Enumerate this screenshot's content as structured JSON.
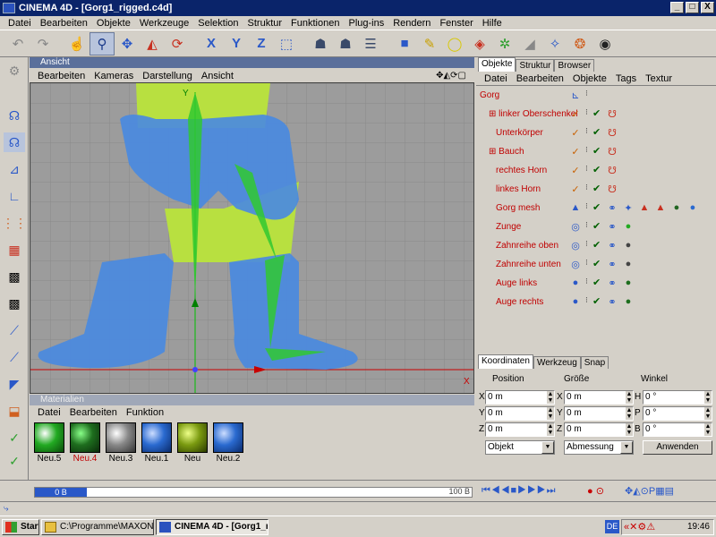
{
  "window": {
    "title": "CINEMA 4D - [Gorg1_rigged.c4d]",
    "min": "_",
    "max": "□",
    "close": "X"
  },
  "menubar": [
    "Datei",
    "Bearbeiten",
    "Objekte",
    "Werkzeuge",
    "Selektion",
    "Struktur",
    "Funktionen",
    "Plug-ins",
    "Rendern",
    "Fenster",
    "Hilfe"
  ],
  "viewport": {
    "title": "Ansicht",
    "menu": [
      "Bearbeiten",
      "Kameras",
      "Darstellung",
      "Ansicht"
    ],
    "axis_x": "X",
    "axis_y": "Y"
  },
  "materials": {
    "title": "Materialien",
    "menu": [
      "Datei",
      "Bearbeiten",
      "Funktion"
    ],
    "items": [
      {
        "label": "Neu.5",
        "color": "#22aa22"
      },
      {
        "label": "Neu.4",
        "color": "#1e6e1e",
        "active": true
      },
      {
        "label": "Neu.3",
        "color": "#888888"
      },
      {
        "label": "Neu.1",
        "color": "#2a6ad0"
      },
      {
        "label": "Neu",
        "color": "#7a9a10"
      },
      {
        "label": "Neu.2",
        "color": "#2a6ad0"
      }
    ]
  },
  "objects": {
    "tabs": [
      "Objekte",
      "Struktur",
      "Browser"
    ],
    "menu": [
      "Datei",
      "Bearbeiten",
      "Objekte",
      "Tags",
      "Textur"
    ],
    "rows": [
      {
        "name": "Gorg",
        "expand": "−",
        "type_icon": "L0",
        "kind": "root"
      },
      {
        "name": "linker Oberschenkel",
        "expand": "+",
        "type_icon": "bone"
      },
      {
        "name": "Unterkörper",
        "expand": "",
        "type_icon": "bone"
      },
      {
        "name": "Bauch",
        "expand": "+",
        "type_icon": "bone"
      },
      {
        "name": "rechtes Horn",
        "expand": "",
        "type_icon": "bone"
      },
      {
        "name": "linkes Horn",
        "expand": "",
        "type_icon": "bone"
      },
      {
        "name": "Gorg mesh",
        "expand": "",
        "type_icon": "mesh"
      },
      {
        "name": "Zunge",
        "expand": "",
        "type_icon": "ring"
      },
      {
        "name": "Zahnreihe oben",
        "expand": "",
        "type_icon": "ring"
      },
      {
        "name": "Zahnreihe unten",
        "expand": "",
        "type_icon": "ring"
      },
      {
        "name": "Auge links",
        "expand": "",
        "type_icon": "sphere"
      },
      {
        "name": "Auge rechts",
        "expand": "",
        "type_icon": "sphere"
      }
    ]
  },
  "coords": {
    "tabs": [
      "Koordinaten",
      "Werkzeug",
      "Snap"
    ],
    "headers": [
      "Position",
      "Größe",
      "Winkel"
    ],
    "pos": [
      {
        "axis": "X",
        "value": "0 m"
      },
      {
        "axis": "Y",
        "value": "0 m"
      },
      {
        "axis": "Z",
        "value": "0 m"
      }
    ],
    "size": [
      {
        "axis": "X",
        "value": "0 m"
      },
      {
        "axis": "Y",
        "value": "0 m"
      },
      {
        "axis": "Z",
        "value": "0 m"
      }
    ],
    "angle": [
      {
        "axis": "H",
        "value": "0 °"
      },
      {
        "axis": "P",
        "value": "0 °"
      },
      {
        "axis": "B",
        "value": "0 °"
      }
    ],
    "mode": "Objekt",
    "measure": "Abmessung",
    "apply": "Anwenden"
  },
  "timeline": {
    "start": "0 B",
    "end": "100 B"
  },
  "taskbar": {
    "start": "Start",
    "items": [
      "C:\\Programme\\MAXON\\C...",
      "CINEMA 4D - [Gorg1_r..."
    ],
    "lang": "DE",
    "clock": "19:46"
  }
}
